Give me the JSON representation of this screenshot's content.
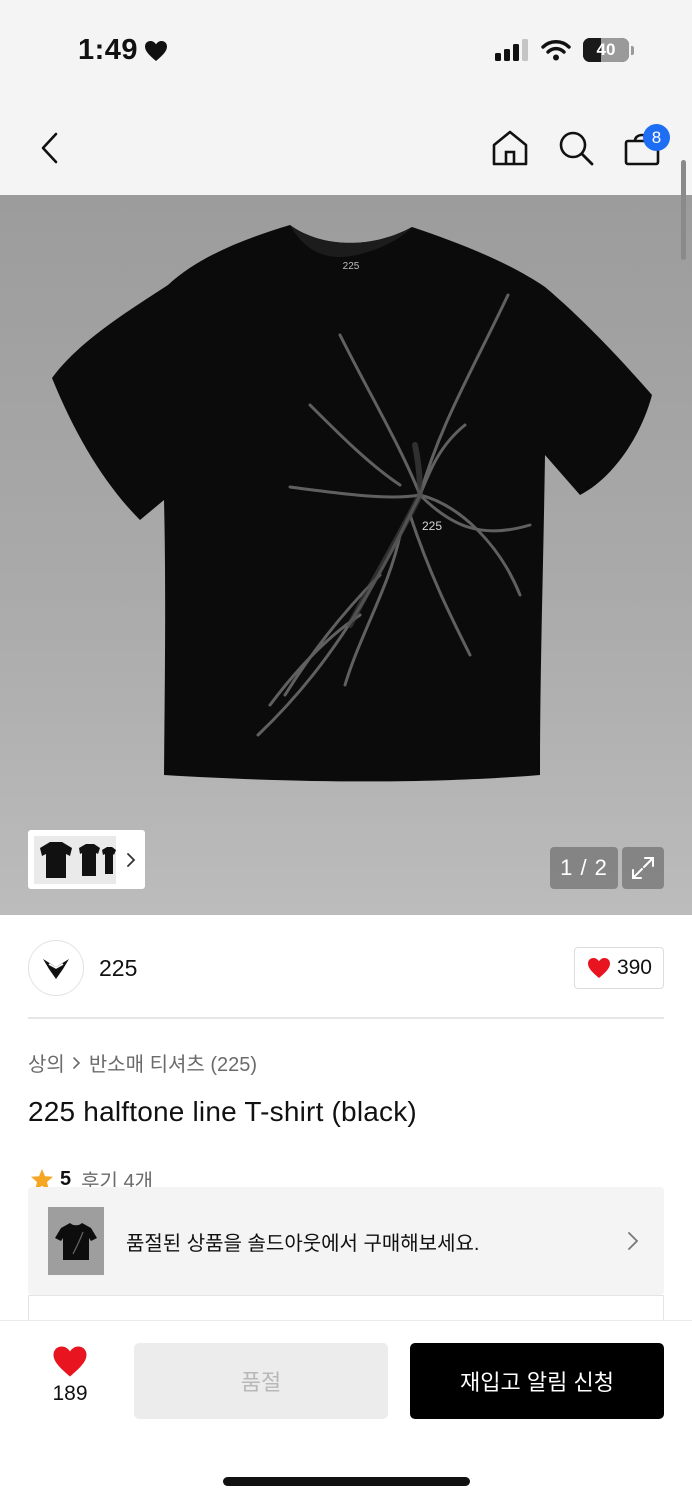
{
  "status_bar": {
    "time": "1:49",
    "battery": "40"
  },
  "header": {
    "cart_count": "8"
  },
  "gallery": {
    "shirt_label": "225",
    "graphic_label": "225",
    "pager": "1 / 2"
  },
  "brand": {
    "name": "225",
    "likes": "390"
  },
  "breadcrumb": {
    "category": "상의",
    "subcategory": "반소매 티셔츠 (225)"
  },
  "product": {
    "title": "225 halftone line T-shirt (black)",
    "rating": "5",
    "reviews": "후기 4개"
  },
  "soldout_banner": {
    "message": "품절된 상품을 솔드아웃에서 구매해보세요."
  },
  "bottom_bar": {
    "wish_count": "189",
    "soldout_label": "품절",
    "restock_label": "재입고 알림 신청"
  },
  "colors": {
    "accent_blue": "#1e6df5",
    "heart_red": "#e8141f",
    "star_orange": "#f5a623"
  }
}
